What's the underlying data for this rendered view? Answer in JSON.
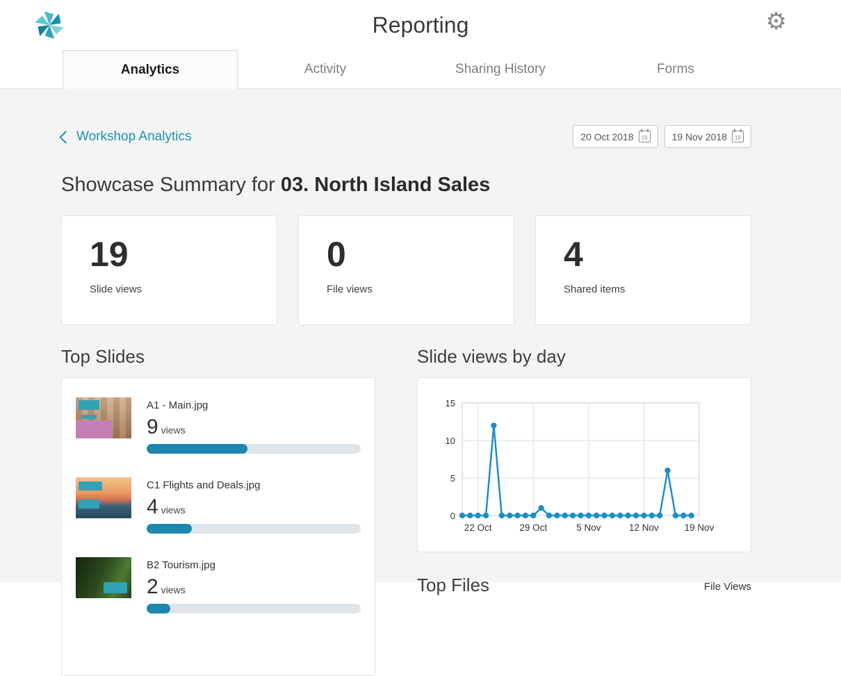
{
  "header": {
    "title": "Reporting"
  },
  "icons": {
    "gear_glyph": "⚙"
  },
  "tabs": [
    {
      "label": "Analytics",
      "active": true
    },
    {
      "label": "Activity",
      "active": false
    },
    {
      "label": "Sharing History",
      "active": false
    },
    {
      "label": "Forms",
      "active": false
    }
  ],
  "breadcrumb": {
    "label": "Workshop Analytics"
  },
  "date_range": {
    "start": "20 Oct 2018",
    "end": "19 Nov 2018",
    "icon_day": "19"
  },
  "summary": {
    "prefix": "Showcase Summary for ",
    "showcase_name": "03. North Island Sales"
  },
  "stats": [
    {
      "value": "19",
      "label": "Slide views"
    },
    {
      "value": "0",
      "label": "File views"
    },
    {
      "value": "4",
      "label": "Shared items"
    }
  ],
  "top_slides": {
    "title": "Top Slides",
    "items": [
      {
        "name": "A1 - Main.jpg",
        "views": "9",
        "views_unit": "views",
        "bar_percent": 47
      },
      {
        "name": "C1 Flights and Deals.jpg",
        "views": "4",
        "views_unit": "views",
        "bar_percent": 21
      },
      {
        "name": "B2 Tourism.jpg",
        "views": "2",
        "views_unit": "views",
        "bar_percent": 11
      }
    ]
  },
  "chart_section": {
    "title": "Slide views by day"
  },
  "top_files": {
    "title": "Top Files",
    "column_header": "File Views"
  },
  "chart_data": {
    "type": "line",
    "title": "Slide views by day",
    "x": [
      "20 Oct",
      "21 Oct",
      "22 Oct",
      "23 Oct",
      "24 Oct",
      "25 Oct",
      "26 Oct",
      "27 Oct",
      "28 Oct",
      "29 Oct",
      "30 Oct",
      "31 Oct",
      "1 Nov",
      "2 Nov",
      "3 Nov",
      "4 Nov",
      "5 Nov",
      "6 Nov",
      "7 Nov",
      "8 Nov",
      "9 Nov",
      "10 Nov",
      "11 Nov",
      "12 Nov",
      "13 Nov",
      "14 Nov",
      "15 Nov",
      "16 Nov",
      "17 Nov",
      "18 Nov"
    ],
    "values": [
      0,
      0,
      0,
      0,
      12,
      0,
      0,
      0,
      0,
      0,
      1,
      0,
      0,
      0,
      0,
      0,
      0,
      0,
      0,
      0,
      0,
      0,
      0,
      0,
      0,
      0,
      6,
      0,
      0,
      0
    ],
    "y_ticks": [
      0,
      5,
      10,
      15
    ],
    "ylim": [
      0,
      15
    ],
    "x_domain": 30,
    "x_tick_positions": [
      2,
      9,
      16,
      23,
      30
    ],
    "x_tick_labels": [
      "22 Oct",
      "29 Oct",
      "5 Nov",
      "12 Nov",
      "19 Nov"
    ],
    "line_color": "#1e8fc2",
    "grid": true,
    "legend": false
  },
  "colors": {
    "accent": "#1f93af",
    "bar_fill": "#1d87ae",
    "bar_track": "#dfe5e9"
  }
}
